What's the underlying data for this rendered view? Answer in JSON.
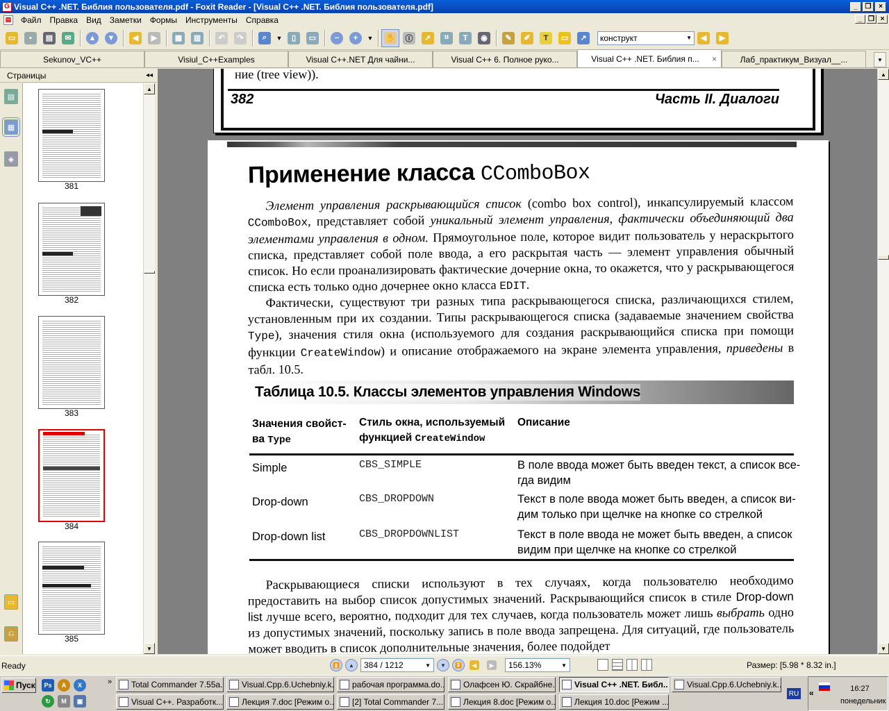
{
  "window": {
    "title": "Visual C++ .NET. Библия пользователя.pdf - Foxit Reader - [Visual C++ .NET. Библия пользователя.pdf]",
    "min": "_",
    "max": "□",
    "close": "×",
    "restore": "❐"
  },
  "menu": [
    "Файл",
    "Правка",
    "Вид",
    "Заметки",
    "Формы",
    "Инструменты",
    "Справка"
  ],
  "search": {
    "value": "конструкт"
  },
  "tabs": [
    {
      "label": "Sekunov_VC++"
    },
    {
      "label": "Visiul_C++Examples"
    },
    {
      "label": "Visual C++.NET Для чайни..."
    },
    {
      "label": "Visual C++ 6. Полное руко..."
    },
    {
      "label": "Visual C++ .NET. Библия п...",
      "active": true
    },
    {
      "label": "Лаб_практикум_Визуал__..."
    }
  ],
  "tab_close": "×",
  "sidebar": {
    "title": "Страницы",
    "collapse": "◂◂",
    "thumbnails": [
      {
        "page": "381",
        "selected": false,
        "heading": "Поиск и выбор элементов"
      },
      {
        "page": "382",
        "selected": false,
        "heading": "Работа с данными элемента"
      },
      {
        "page": "383",
        "selected": false,
        "heading": ""
      },
      {
        "page": "384",
        "selected": true,
        "heading": "Применение класса CComboBox"
      },
      {
        "page": "385",
        "selected": false,
        "heading": "Динамическое изменение атрибутов элемента управления"
      }
    ]
  },
  "doc": {
    "prev_tail": "ние (tree view)).",
    "prev_page_num": "382",
    "prev_part": "Часть II. Диалоги",
    "heading_text": "Применение класса ",
    "heading_code": "CComboBox",
    "para1_a": "Элемент управления раскрывающийся список",
    "para1_b": " (combo box control), инкапсулируемый классом ",
    "para1_code1": "CComboBox",
    "para1_c": ", представляет собой ",
    "para1_d": "уникальный элемент управления, фактически объединяющий два элементами управления в одном.",
    "para1_e": " Прямоугольное поле, которое видит пользователь у нераскрытого списка, представляет собой поле ввода, а его раскрытая часть — элемент управления обычный список. Но если проанализировать фактические дочерние окна, то окажется, что у раскрывающегося списка есть только одно дочернее окно класса ",
    "para1_code2": "EDIT",
    "para1_f": ".",
    "para2_a": "Фактически, существуют три разных типа раскрывающегося списка, различающихся стилем, установленным при их создании. Типы раскрывающегося списка (задаваемые значением свойства ",
    "para2_code1": "Type",
    "para2_b": "), значения стиля окна (используемого для создания раскрывающийся списка при помощи функции ",
    "para2_code2": "CreateWindow",
    "para2_c": ") и описание отображаемого на экране элемента управления, ",
    "para2_d": "приведены",
    "para2_e": " в табл. 10.5.",
    "table_caption": "Таблица 10.5. Классы элементов управления Windows",
    "col1_a": "Значения свойст-",
    "col1_b": "ва ",
    "col1_code": "Type",
    "col2_a": "Стиль окна, используемый",
    "col2_b": "функцией ",
    "col2_code": "CreateWindow",
    "col3": "Описание",
    "rows": [
      {
        "type": "Simple",
        "style": "CBS_SIMPLE",
        "desc1": "В поле ввода может быть введен текст, а список все-",
        "desc2": "гда видим"
      },
      {
        "type": "Drop-down",
        "style": "CBS_DROPDOWN",
        "desc1": "Текст в поле ввода может быть введен, а список ви-",
        "desc2": "дим только при щелчке на кнопке со стрелкой"
      },
      {
        "type": "Drop-down list",
        "style": "CBS_DROPDOWNLIST",
        "desc1": "Текст в поле ввода не может быть введен, а список",
        "desc2": "видим при щелчке на кнопке со стрелкой"
      }
    ],
    "para3_a": "Раскрывающиеся списки используют в тех случаях, когда пользователю необходимо предоставить на выбор список допустимых значений. Раскрывающийся список в стиле ",
    "para3_b": "Drop-down list",
    "para3_c": " лучше всего, вероятно, подходит для тех случаев, когда пользователь может лишь ",
    "para3_d": "выбрать",
    "para3_e": " одно из допустимых значений, поскольку запись в поле ввода запрещена. Для ситуаций, где пользователь может вводить в список дополнительные значения, более подойдет"
  },
  "status": {
    "ready": "Ready",
    "page_field": "384 / 1212",
    "zoom": "156.13%",
    "size": "Размер: [5.98 * 8.32 in.]"
  },
  "taskbar": {
    "start": "Пуск",
    "row1": [
      {
        "label": "Total Commander 7.55a..."
      },
      {
        "label": "Visual.Cpp.6.Uchebniy.k..."
      },
      {
        "label": "рабочая программа.do..."
      },
      {
        "label": "Олафсен Ю. Скрайбне..."
      },
      {
        "label": "Visual C++ .NET. Библ...",
        "active": true
      },
      {
        "label": "Visual.Cpp.6.Uchebniy.k..."
      }
    ],
    "row2": [
      {
        "label": "Visual C++. Разработк..."
      },
      {
        "label": "Лекция 7.doc [Режим о..."
      },
      {
        "label": "[2] Total Commander 7...."
      },
      {
        "label": "Лекция 8.doc [Режим о..."
      },
      {
        "label": "Лекция 10.doc [Режим ..."
      }
    ],
    "lang": "RU",
    "time": "16:27",
    "day": "понедельник"
  },
  "colors": {
    "accent": "#0a5fd8",
    "selected_thumb": "#e00000"
  }
}
